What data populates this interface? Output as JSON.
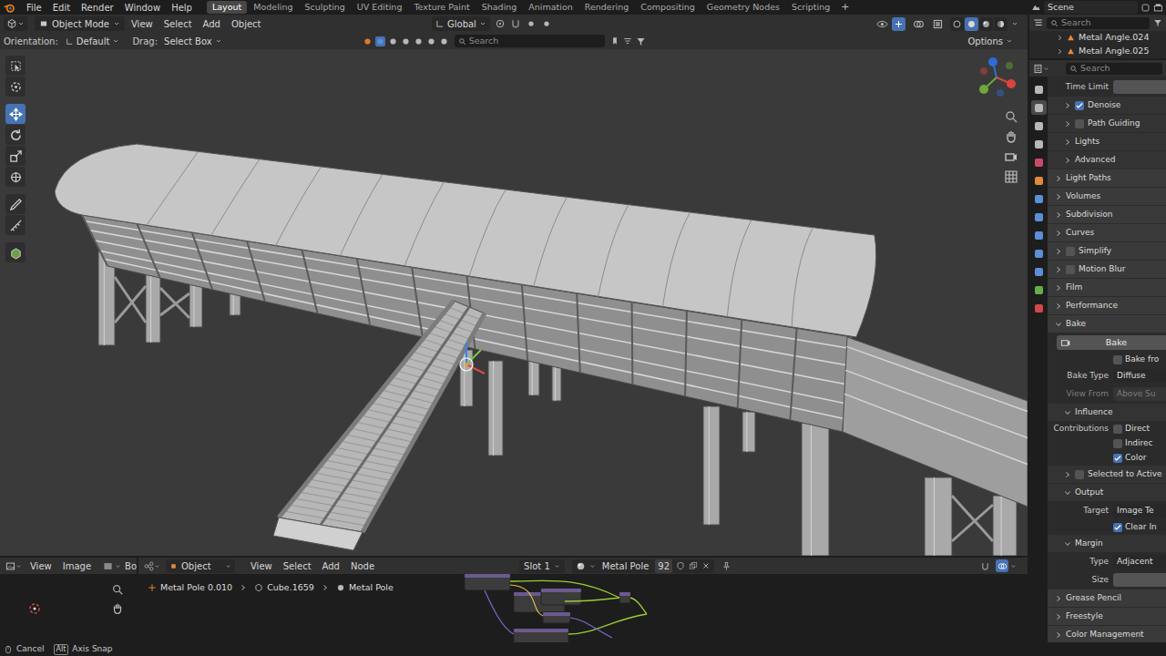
{
  "topbar": {
    "menus": [
      "File",
      "Edit",
      "Render",
      "Window",
      "Help"
    ],
    "workspaces": [
      {
        "label": "Layout",
        "selected": true
      },
      {
        "label": "Modeling",
        "selected": false
      },
      {
        "label": "Sculpting",
        "selected": false
      },
      {
        "label": "UV Editing",
        "selected": false
      },
      {
        "label": "Texture Paint",
        "selected": false
      },
      {
        "label": "Shading",
        "selected": false
      },
      {
        "label": "Animation",
        "selected": false
      },
      {
        "label": "Rendering",
        "selected": false
      },
      {
        "label": "Compositing",
        "selected": false
      },
      {
        "label": "Geometry Nodes",
        "selected": false
      },
      {
        "label": "Scripting",
        "selected": false
      }
    ],
    "add_workspace": "+",
    "scene": "Scene"
  },
  "view3d": {
    "mode": "Object Mode",
    "menus": [
      "View",
      "Select",
      "Add",
      "Object"
    ],
    "transform_orientation": "Global",
    "orientation_label": "Orientation:",
    "orientation": "Default",
    "drag_label": "Drag:",
    "drag": "Select Box",
    "search_placeholder": "Search",
    "options": "Options",
    "shading_modes": [
      {
        "selected": false
      },
      {
        "selected": true
      },
      {
        "selected": false
      },
      {
        "selected": false
      }
    ],
    "tools": [
      {
        "kind": "select",
        "selected": false
      },
      {
        "kind": "cursor",
        "selected": false
      },
      {
        "kind": "move",
        "selected": true
      },
      {
        "kind": "rotate",
        "selected": false
      },
      {
        "kind": "scale",
        "selected": false
      },
      {
        "kind": "transform",
        "selected": false
      },
      {
        "kind": "annotate",
        "selected": false
      },
      {
        "kind": "measure",
        "selected": false
      },
      {
        "kind": "add-cube",
        "selected": false
      }
    ]
  },
  "outliner": {
    "search_placeholder": "Search",
    "items": [
      {
        "label": "Metal Angle.024"
      },
      {
        "label": "Metal Angle.025"
      }
    ]
  },
  "properties": {
    "search_placeholder": "Search",
    "tabs": [
      {
        "selected": false,
        "color": "#b8b8b8"
      },
      {
        "selected": true,
        "color": "#b8b8b8"
      },
      {
        "selected": false,
        "color": "#b8b8b8"
      },
      {
        "selected": false,
        "color": "#b8b8b8"
      },
      {
        "selected": false,
        "color": "#c94a6b"
      },
      {
        "selected": false,
        "color": "#e08a3c"
      },
      {
        "selected": false,
        "color": "#5b8fd6"
      },
      {
        "selected": false,
        "color": "#5b8fd6"
      },
      {
        "selected": false,
        "color": "#5b8fd6"
      },
      {
        "selected": false,
        "color": "#5b8fd6"
      },
      {
        "selected": false,
        "color": "#5b8fd6"
      },
      {
        "selected": false,
        "color": "#63b04a"
      },
      {
        "selected": false,
        "color": "#d24848"
      }
    ],
    "rows": [
      {
        "kind": "field",
        "label": "Time Limit",
        "disabled": false
      },
      {
        "kind": "subpanel",
        "label": "Denoise",
        "expanded": false,
        "checked": true
      },
      {
        "kind": "subpanel",
        "label": "Path Guiding",
        "expanded": false,
        "checked": false
      },
      {
        "kind": "subpanel",
        "label": "Lights",
        "expanded": false
      },
      {
        "kind": "subpanel",
        "label": "Advanced",
        "expanded": false
      },
      {
        "kind": "panel",
        "label": "Light Paths",
        "expanded": false
      },
      {
        "kind": "panel",
        "label": "Volumes",
        "expanded": false
      },
      {
        "kind": "panel",
        "label": "Subdivision",
        "expanded": false
      },
      {
        "kind": "panel",
        "label": "Curves",
        "expanded": false
      },
      {
        "kind": "panel",
        "label": "Simplify",
        "expanded": false,
        "checked": false
      },
      {
        "kind": "panel",
        "label": "Motion Blur",
        "expanded": false,
        "checked": false
      },
      {
        "kind": "panel",
        "label": "Film",
        "expanded": false
      },
      {
        "kind": "panel",
        "label": "Performance",
        "expanded": false
      },
      {
        "kind": "panel",
        "label": "Bake",
        "expanded": true
      },
      {
        "kind": "button",
        "label": "Bake"
      },
      {
        "kind": "check",
        "label": "Bake fro",
        "checked": false
      },
      {
        "kind": "field",
        "label": "Bake Type",
        "value": "Diffuse",
        "disabled": false
      },
      {
        "kind": "field",
        "label": "View From",
        "value": "Above Su",
        "disabled": true
      },
      {
        "kind": "subpanel",
        "label": "Influence",
        "expanded": true
      },
      {
        "kind": "check",
        "heading": "Contributions",
        "label": "Direct",
        "checked": false
      },
      {
        "kind": "check",
        "label": "Indirec",
        "checked": false
      },
      {
        "kind": "check",
        "label": "Color",
        "checked": true
      },
      {
        "kind": "subpanel",
        "label": "Selected to Active",
        "expanded": false,
        "checked": false
      },
      {
        "kind": "subpanel",
        "label": "Output",
        "expanded": true
      },
      {
        "kind": "field",
        "label": "Target",
        "value": "Image Te",
        "disabled": false
      },
      {
        "kind": "check",
        "label": "Clear In",
        "checked": true
      },
      {
        "kind": "subpanel",
        "label": "Margin",
        "expanded": true
      },
      {
        "kind": "field",
        "label": "Type",
        "value": "Adjacent",
        "disabled": false
      },
      {
        "kind": "field",
        "label": "Size",
        "disabled": false
      },
      {
        "kind": "panel",
        "label": "Grease Pencil",
        "expanded": false
      },
      {
        "kind": "panel",
        "label": "Freestyle",
        "expanded": false
      },
      {
        "kind": "panel",
        "label": "Color Management",
        "expanded": false
      }
    ]
  },
  "image_editor": {
    "menus": [
      "View",
      "Image"
    ],
    "cut_label": "Bo"
  },
  "node_editor": {
    "context": "Object",
    "menus": [
      "View",
      "Select",
      "Add",
      "Node"
    ],
    "slot": "Slot 1",
    "material": "Metal Pole",
    "users": "92",
    "breadcrumb": [
      "Metal Pole 0.010",
      "Cube.1659",
      "Metal Pole"
    ]
  },
  "status_bar": {
    "cancel": "Cancel",
    "alt_key": "Alt",
    "axis_snap": "Axis Snap"
  }
}
